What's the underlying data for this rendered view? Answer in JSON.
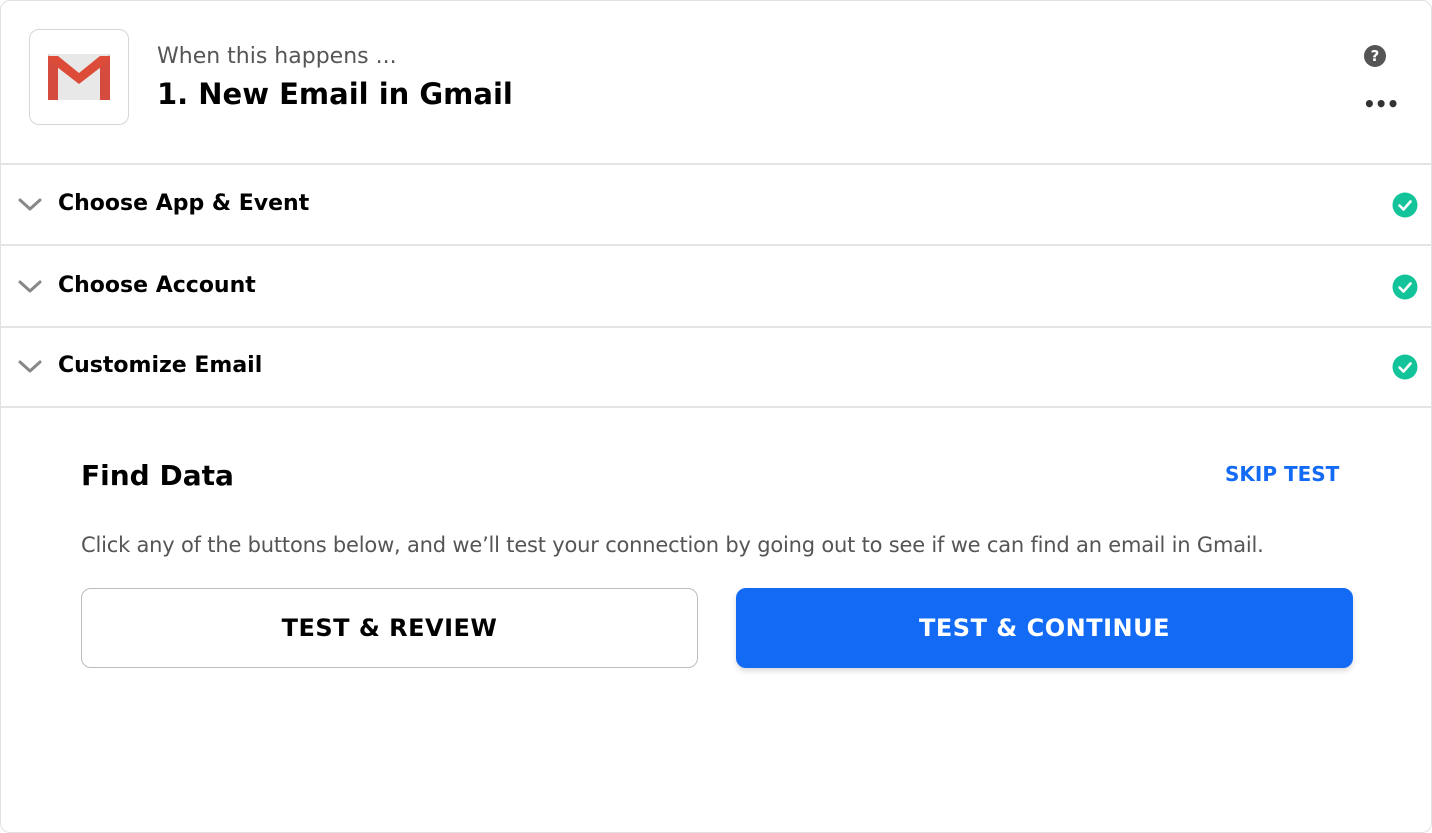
{
  "header": {
    "app_icon": "gmail-icon",
    "subtitle": "When this happens ...",
    "title": "1. New Email in Gmail",
    "help_icon": "question-circle-icon",
    "help_glyph": "?",
    "more_icon": "ellipsis-icon",
    "more_glyph": "•••"
  },
  "sections": [
    {
      "label": "Choose App & Event",
      "status": "complete",
      "status_icon": "check-circle-icon"
    },
    {
      "label": "Choose Account",
      "status": "complete",
      "status_icon": "check-circle-icon"
    },
    {
      "label": "Customize Email",
      "status": "complete",
      "status_icon": "check-circle-icon"
    }
  ],
  "find_data": {
    "title": "Find Data",
    "skip_label": "SKIP TEST",
    "description": "Click any of the buttons below, and we’ll test your connection by going out to see if we can find an email in Gmail.",
    "review_button": "TEST & REVIEW",
    "continue_button": "TEST & CONTINUE"
  },
  "colors": {
    "accent_blue": "#136bf5",
    "success_green": "#13c49a",
    "gmail_red": "#dd4b39"
  }
}
